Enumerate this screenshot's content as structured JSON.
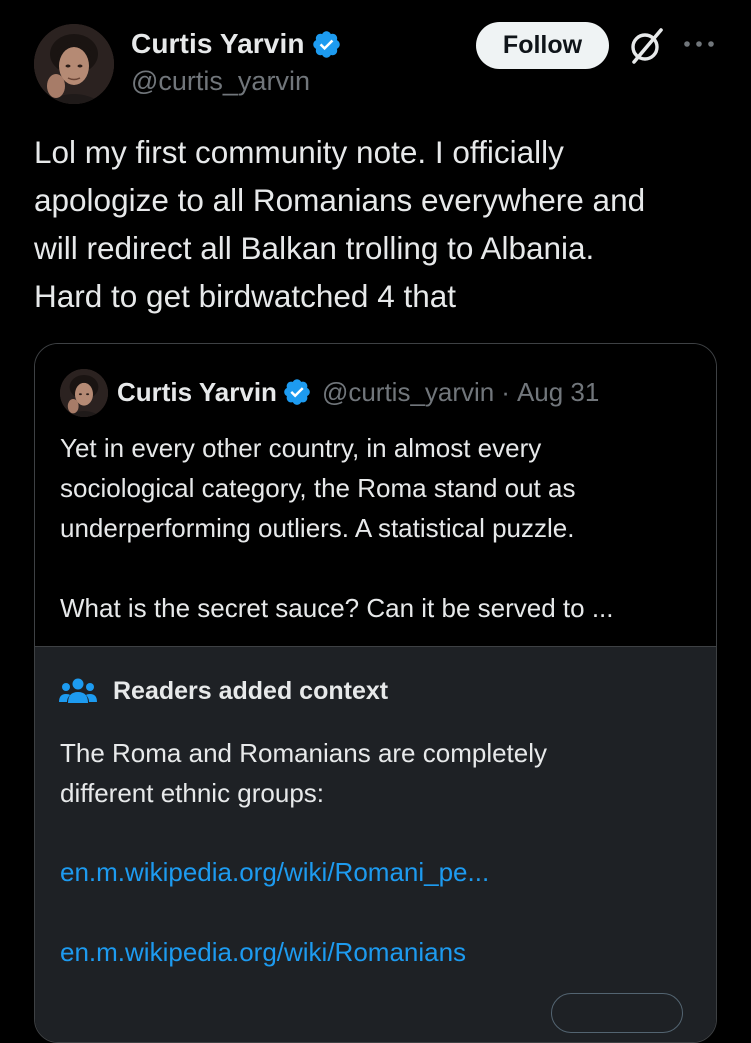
{
  "author": {
    "display_name": "Curtis Yarvin",
    "handle": "@curtis_yarvin",
    "verified": true
  },
  "header": {
    "follow_label": "Follow",
    "icons": [
      "grok-icon",
      "more-icon",
      "verified-icon"
    ]
  },
  "tweet": {
    "lines": [
      "Lol my first community note. I officially",
      "apologize to all Romanians everywhere and",
      "will redirect all Balkan trolling to Albania.",
      "Hard to get birdwatched 4 that"
    ]
  },
  "quote": {
    "display_name": "Curtis Yarvin",
    "handle": "@curtis_yarvin",
    "separator": "·",
    "date": "Aug 31",
    "lines": [
      "Yet in every other country, in almost every",
      "sociological category, the Roma stand out as",
      "underperforming outliers. A statistical puzzle."
    ],
    "second_paragraph": "What is the secret sauce? Can it be served to ..."
  },
  "community_note": {
    "title": "Readers added context",
    "icon": "people-icon",
    "lines": [
      "The Roma and Romanians are completely",
      "different ethnic groups:"
    ],
    "links": [
      "en.m.wikipedia.org/wiki/Romani_pe...",
      "en.m.wikipedia.org/wiki/Romanians"
    ]
  },
  "colors": {
    "background": "#000000",
    "text": "#e7e9ea",
    "secondary_text": "#71767b",
    "link": "#1d9bf0",
    "verified": "#1d9bf0",
    "note_background": "#1e2125",
    "border": "#3e4144"
  }
}
